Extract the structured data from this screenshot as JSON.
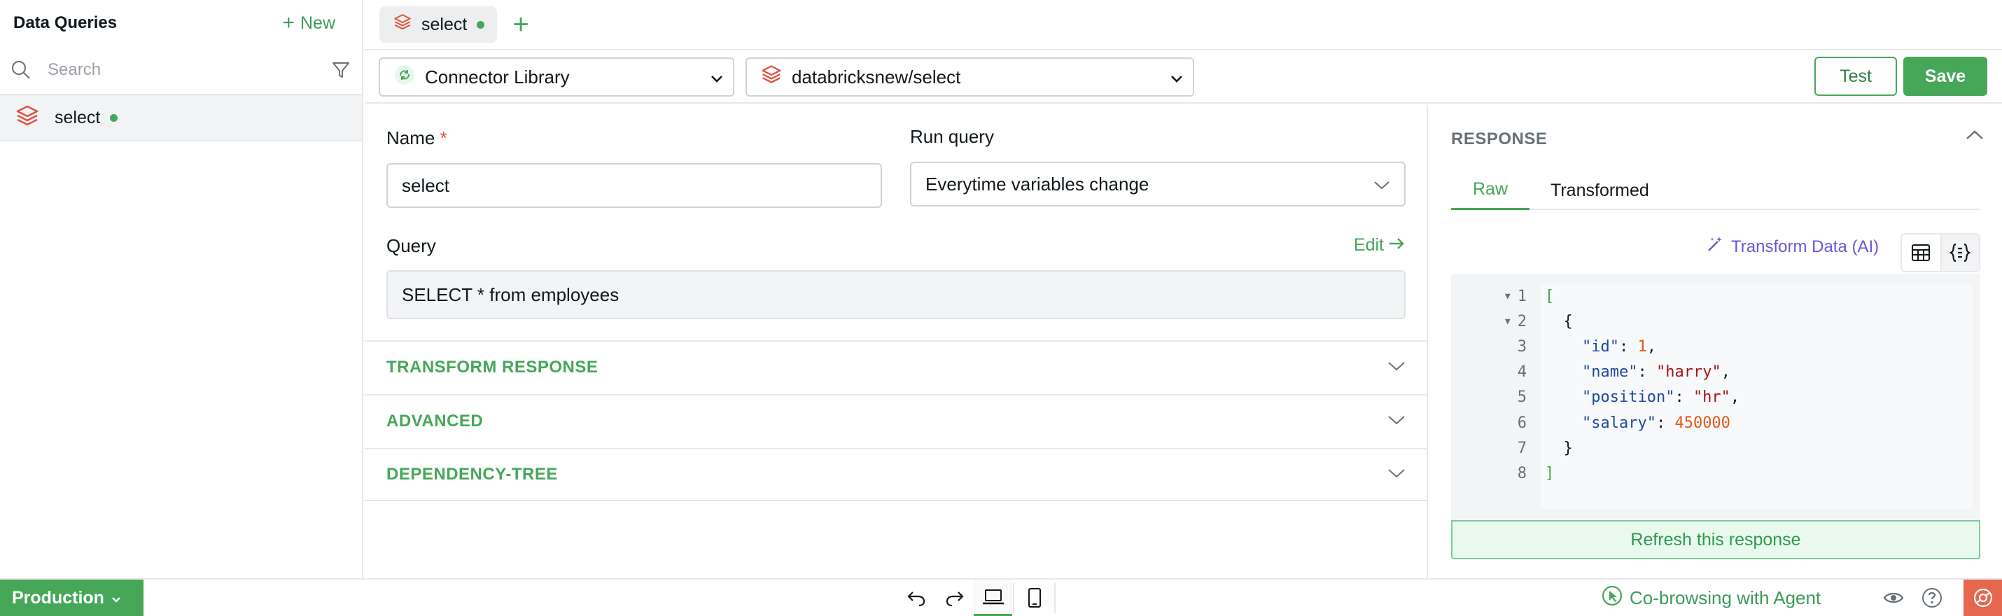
{
  "sidebar": {
    "title": "Data Queries",
    "new_label": "New",
    "search_placeholder": "Search",
    "items": [
      {
        "label": "select",
        "status": "saved"
      }
    ]
  },
  "tabs": [
    {
      "label": "select"
    }
  ],
  "toolbar": {
    "connector_label": "Connector Library",
    "source_label": "databricksnew/select",
    "test_label": "Test",
    "save_label": "Save"
  },
  "form": {
    "name_label": "Name",
    "required_mark": "*",
    "name_value": "select",
    "run_query_label": "Run query",
    "run_query_value": "Everytime variables change",
    "query_label": "Query",
    "edit_label": "Edit",
    "query_value": "SELECT * from employees",
    "sections": [
      "TRANSFORM RESPONSE",
      "ADVANCED",
      "DEPENDENCY-TREE"
    ]
  },
  "response": {
    "title": "RESPONSE",
    "tabs": [
      "Raw",
      "Transformed"
    ],
    "active_tab": "Raw",
    "transform_ai_label": "Transform Data (AI)",
    "line_numbers": [
      "1",
      "2",
      "3",
      "4",
      "5",
      "6",
      "7",
      "8"
    ],
    "json": {
      "open_bracket": "[",
      "open_brace": "{",
      "fields": [
        {
          "key": "\"id\"",
          "value": "1",
          "type": "number",
          "trail": ","
        },
        {
          "key": "\"name\"",
          "value": "\"harry\"",
          "type": "string",
          "trail": ","
        },
        {
          "key": "\"position\"",
          "value": "\"hr\"",
          "type": "string",
          "trail": ","
        },
        {
          "key": "\"salary\"",
          "value": "450000",
          "type": "number",
          "trail": ""
        }
      ],
      "close_brace": "}",
      "close_bracket": "]"
    },
    "refresh_label": "Refresh this response"
  },
  "footer": {
    "environment": "Production",
    "cobrowse_label": "Co-browsing with Agent"
  },
  "colors": {
    "accent": "#46a758",
    "ai": "#6e56cf",
    "required": "#e5484d",
    "corner": "#e5674d"
  }
}
